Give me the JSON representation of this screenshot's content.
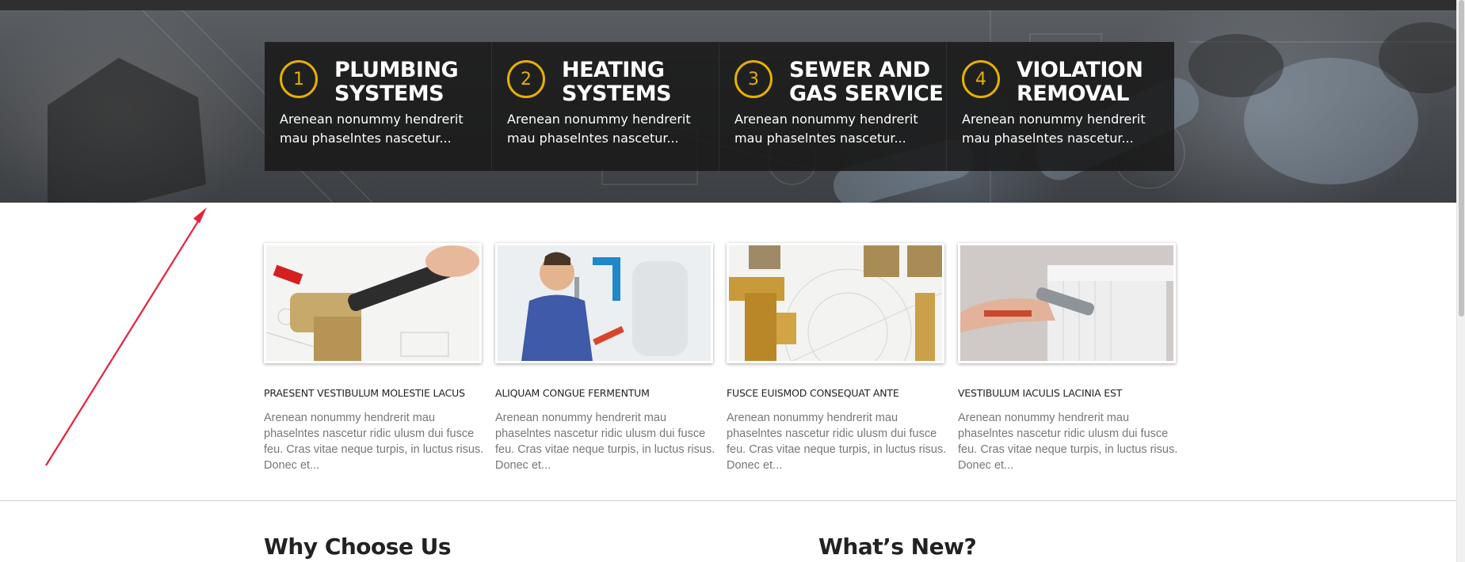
{
  "hero": {
    "steps": [
      {
        "number": "1",
        "title": "PLUMBING SYSTEMS",
        "text": "Arenean nonummy hendrerit mau phaselntes nascetur..."
      },
      {
        "number": "2",
        "title": "HEATING SYSTEMS",
        "text": "Arenean nonummy hendrerit mau phaselntes nascetur..."
      },
      {
        "number": "3",
        "title": "SEWER AND GAS SERVICE",
        "text": "Arenean nonummy hendrerit mau phaselntes nascetur..."
      },
      {
        "number": "4",
        "title": "VIOLATION REMOVAL",
        "text": "Arenean nonummy hendrerit mau phaselntes nascetur..."
      }
    ]
  },
  "cards": [
    {
      "title": "PRAESENT VESTIBULUM MOLESTIE LACUS",
      "text": "Arenean nonummy hendrerit mau phaselntes nascetur ridic ulusm dui fusce feu. Cras vitae neque turpis, in luctus risus. Donec et..."
    },
    {
      "title": "ALIQUAM CONGUE FERMENTUM",
      "text": "Arenean nonummy hendrerit mau phaselntes nascetur ridic ulusm dui fusce feu. Cras vitae neque turpis, in luctus risus. Donec et..."
    },
    {
      "title": "FUSCE EUISMOD CONSEQUAT ANTE",
      "text": "Arenean nonummy hendrerit mau phaselntes nascetur ridic ulusm dui fusce feu. Cras vitae neque turpis, in luctus risus. Donec et..."
    },
    {
      "title": "VESTIBULUM IACULIS LACINIA EST",
      "text": "Arenean nonummy hendrerit mau phaselntes nascetur ridic ulusm dui fusce feu. Cras vitae neque turpis, in luctus risus. Donec et..."
    }
  ],
  "sections": {
    "why_choose_us": "Why Choose Us",
    "whats_new": "What’s New?"
  },
  "colors": {
    "accent": "#e6b000",
    "annotation_arrow": "#e8213a",
    "step_box": "#191919"
  }
}
